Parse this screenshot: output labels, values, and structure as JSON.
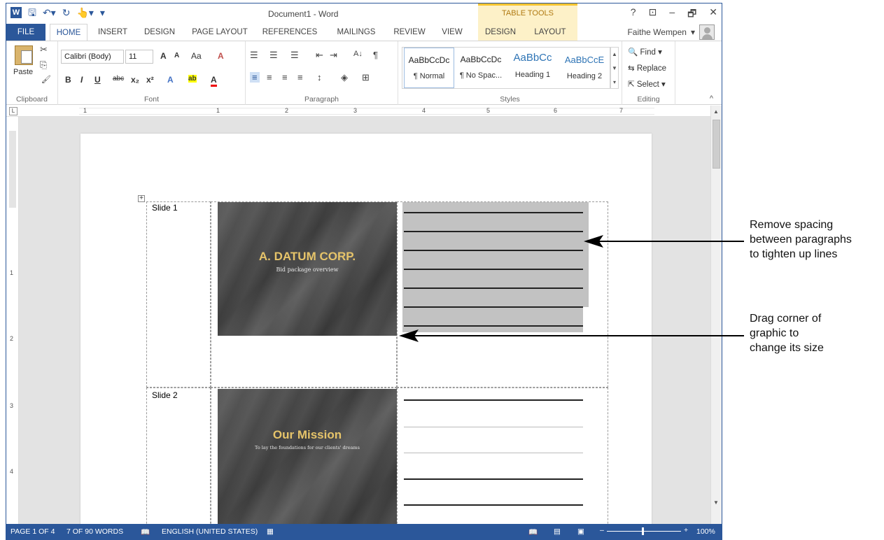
{
  "titlebar": {
    "doc_title": "Document1 - Word",
    "table_tools": "TABLE TOOLS",
    "help": "?",
    "restore_ribbon": "⊡",
    "minimize": "–",
    "restore": "🗗",
    "close": "✕"
  },
  "qat": {
    "word_icon": "W",
    "save": "🖫",
    "undo": "↶▾",
    "redo": "↻",
    "touch": "👆▾",
    "customize": "▾"
  },
  "tabs": [
    "FILE",
    "HOME",
    "INSERT",
    "DESIGN",
    "PAGE LAYOUT",
    "REFERENCES",
    "MAILINGS",
    "REVIEW",
    "VIEW",
    "DESIGN",
    "LAYOUT"
  ],
  "user": {
    "name": "Faithe Wempen",
    "caret": "▾"
  },
  "ribbon": {
    "clipboard": {
      "label": "Clipboard",
      "paste": "Paste",
      "cut_icon": "✂",
      "copy_icon": "⎘",
      "painter_icon": "🖌"
    },
    "font": {
      "label": "Font",
      "family": "Calibri (Body)",
      "size": "11",
      "grow": "A",
      "shrink": "A",
      "case": "Aa",
      "clear": "A",
      "bold": "B",
      "italic": "I",
      "underline": "U",
      "strike": "abc",
      "subscript": "x₂",
      "superscript": "x²",
      "effects": "A",
      "highlight": "ab",
      "color": "A"
    },
    "paragraph": {
      "label": "Paragraph",
      "bullets": "☰",
      "numbering": "☰",
      "multilevel": "☰",
      "decrease": "⇤",
      "increase": "⇥",
      "sort": "A↓",
      "show": "¶",
      "align_left": "≡",
      "center": "≡",
      "align_right": "≡",
      "justify": "≡",
      "spacing": "↕",
      "shading": "◈",
      "borders": "⊞"
    },
    "styles": {
      "label": "Styles",
      "items": [
        {
          "preview": "AaBbCcDc",
          "name": "¶ Normal"
        },
        {
          "preview": "AaBbCcDc",
          "name": "¶ No Spac..."
        },
        {
          "preview": "AaBbCc",
          "name": "Heading 1"
        },
        {
          "preview": "AaBbCcE",
          "name": "Heading 2"
        }
      ]
    },
    "editing": {
      "label": "Editing",
      "find": "Find ▾",
      "replace": "Replace",
      "select": "Select ▾"
    },
    "collapse": "^"
  },
  "ruler": {
    "numbers": [
      "1",
      "1",
      "2",
      "3",
      "4",
      "5",
      "6",
      "7"
    ],
    "vnumbers": [
      "1",
      "1",
      "2",
      "3",
      "4"
    ]
  },
  "document": {
    "slides": [
      {
        "label": "Slide 1",
        "title": "A. DATUM CORP.",
        "subtitle": "Bid package overview"
      },
      {
        "label": "Slide 2",
        "title": "Our Mission",
        "subtitle": "To lay the foundations for our clients' dreams"
      }
    ],
    "move_handle": "+"
  },
  "status": {
    "page": "PAGE 1 OF 4",
    "words": "7 OF 90 WORDS",
    "language": "ENGLISH (UNITED STATES)",
    "zoom": "100%",
    "zoom_minus": "–",
    "zoom_plus": "+"
  },
  "annotations": [
    "Remove spacing between paragraphs to tighten up lines",
    "Drag corner of graphic to change its size"
  ],
  "annotation_lines": [
    [
      "Remove spacing",
      "between paragraphs",
      "to tighten up lines"
    ],
    [
      "Drag corner of",
      "graphic to",
      "change its size"
    ]
  ],
  "colors": {
    "accent": "#2b579a",
    "table_tools": "#fdf1c8",
    "slide_title": "#e6c46a"
  }
}
